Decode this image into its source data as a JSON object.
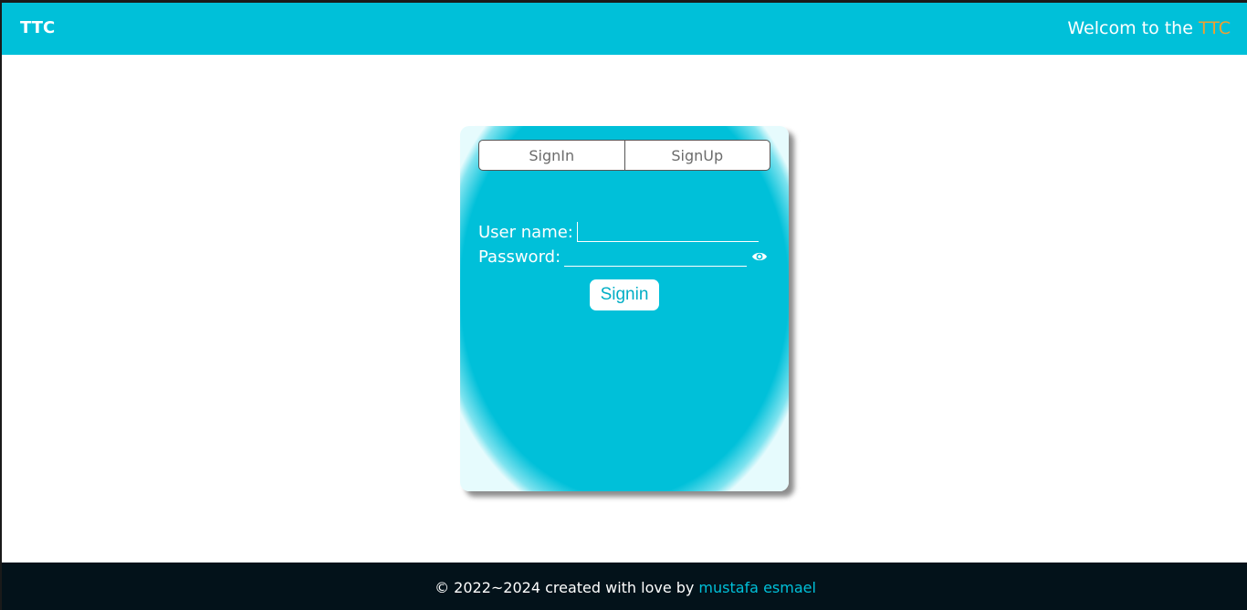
{
  "header": {
    "brand": "TTC",
    "welcome_prefix": "Welcom to the ",
    "welcome_accent": "TTC"
  },
  "auth": {
    "tabs": [
      {
        "label": "SignIn"
      },
      {
        "label": "SignUp"
      }
    ],
    "username_label": "User name:",
    "username_value": "",
    "password_label": "Password:",
    "password_value": "",
    "submit_label": "Signin"
  },
  "footer": {
    "text": "© 2022~2024 created with love by",
    "author": "mustafa esmael"
  },
  "colors": {
    "accent": "#00c0d9",
    "brand_highlight": "#f0a030",
    "footer_bg": "#03121a"
  },
  "icons": {
    "password_toggle": "eye-icon"
  }
}
